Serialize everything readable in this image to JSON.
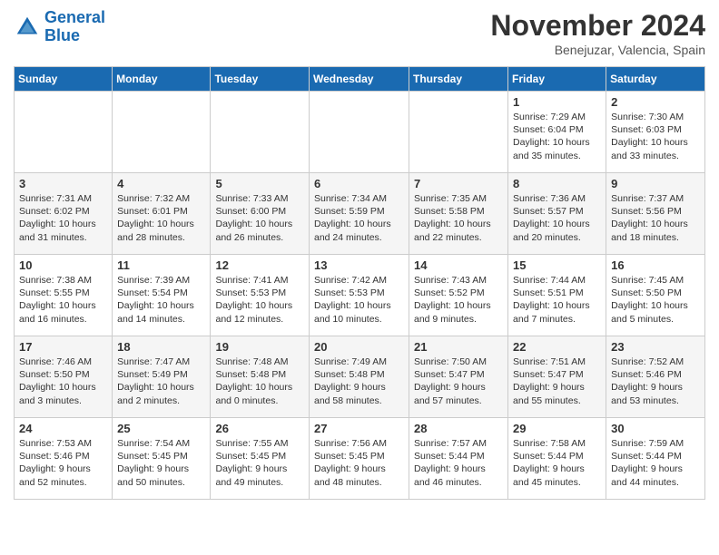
{
  "header": {
    "logo_line1": "General",
    "logo_line2": "Blue",
    "month": "November 2024",
    "location": "Benejuzar, Valencia, Spain"
  },
  "days_of_week": [
    "Sunday",
    "Monday",
    "Tuesday",
    "Wednesday",
    "Thursday",
    "Friday",
    "Saturday"
  ],
  "weeks": [
    [
      {
        "day": "",
        "info": ""
      },
      {
        "day": "",
        "info": ""
      },
      {
        "day": "",
        "info": ""
      },
      {
        "day": "",
        "info": ""
      },
      {
        "day": "",
        "info": ""
      },
      {
        "day": "1",
        "info": "Sunrise: 7:29 AM\nSunset: 6:04 PM\nDaylight: 10 hours\nand 35 minutes."
      },
      {
        "day": "2",
        "info": "Sunrise: 7:30 AM\nSunset: 6:03 PM\nDaylight: 10 hours\nand 33 minutes."
      }
    ],
    [
      {
        "day": "3",
        "info": "Sunrise: 7:31 AM\nSunset: 6:02 PM\nDaylight: 10 hours\nand 31 minutes."
      },
      {
        "day": "4",
        "info": "Sunrise: 7:32 AM\nSunset: 6:01 PM\nDaylight: 10 hours\nand 28 minutes."
      },
      {
        "day": "5",
        "info": "Sunrise: 7:33 AM\nSunset: 6:00 PM\nDaylight: 10 hours\nand 26 minutes."
      },
      {
        "day": "6",
        "info": "Sunrise: 7:34 AM\nSunset: 5:59 PM\nDaylight: 10 hours\nand 24 minutes."
      },
      {
        "day": "7",
        "info": "Sunrise: 7:35 AM\nSunset: 5:58 PM\nDaylight: 10 hours\nand 22 minutes."
      },
      {
        "day": "8",
        "info": "Sunrise: 7:36 AM\nSunset: 5:57 PM\nDaylight: 10 hours\nand 20 minutes."
      },
      {
        "day": "9",
        "info": "Sunrise: 7:37 AM\nSunset: 5:56 PM\nDaylight: 10 hours\nand 18 minutes."
      }
    ],
    [
      {
        "day": "10",
        "info": "Sunrise: 7:38 AM\nSunset: 5:55 PM\nDaylight: 10 hours\nand 16 minutes."
      },
      {
        "day": "11",
        "info": "Sunrise: 7:39 AM\nSunset: 5:54 PM\nDaylight: 10 hours\nand 14 minutes."
      },
      {
        "day": "12",
        "info": "Sunrise: 7:41 AM\nSunset: 5:53 PM\nDaylight: 10 hours\nand 12 minutes."
      },
      {
        "day": "13",
        "info": "Sunrise: 7:42 AM\nSunset: 5:53 PM\nDaylight: 10 hours\nand 10 minutes."
      },
      {
        "day": "14",
        "info": "Sunrise: 7:43 AM\nSunset: 5:52 PM\nDaylight: 10 hours\nand 9 minutes."
      },
      {
        "day": "15",
        "info": "Sunrise: 7:44 AM\nSunset: 5:51 PM\nDaylight: 10 hours\nand 7 minutes."
      },
      {
        "day": "16",
        "info": "Sunrise: 7:45 AM\nSunset: 5:50 PM\nDaylight: 10 hours\nand 5 minutes."
      }
    ],
    [
      {
        "day": "17",
        "info": "Sunrise: 7:46 AM\nSunset: 5:50 PM\nDaylight: 10 hours\nand 3 minutes."
      },
      {
        "day": "18",
        "info": "Sunrise: 7:47 AM\nSunset: 5:49 PM\nDaylight: 10 hours\nand 2 minutes."
      },
      {
        "day": "19",
        "info": "Sunrise: 7:48 AM\nSunset: 5:48 PM\nDaylight: 10 hours\nand 0 minutes."
      },
      {
        "day": "20",
        "info": "Sunrise: 7:49 AM\nSunset: 5:48 PM\nDaylight: 9 hours\nand 58 minutes."
      },
      {
        "day": "21",
        "info": "Sunrise: 7:50 AM\nSunset: 5:47 PM\nDaylight: 9 hours\nand 57 minutes."
      },
      {
        "day": "22",
        "info": "Sunrise: 7:51 AM\nSunset: 5:47 PM\nDaylight: 9 hours\nand 55 minutes."
      },
      {
        "day": "23",
        "info": "Sunrise: 7:52 AM\nSunset: 5:46 PM\nDaylight: 9 hours\nand 53 minutes."
      }
    ],
    [
      {
        "day": "24",
        "info": "Sunrise: 7:53 AM\nSunset: 5:46 PM\nDaylight: 9 hours\nand 52 minutes."
      },
      {
        "day": "25",
        "info": "Sunrise: 7:54 AM\nSunset: 5:45 PM\nDaylight: 9 hours\nand 50 minutes."
      },
      {
        "day": "26",
        "info": "Sunrise: 7:55 AM\nSunset: 5:45 PM\nDaylight: 9 hours\nand 49 minutes."
      },
      {
        "day": "27",
        "info": "Sunrise: 7:56 AM\nSunset: 5:45 PM\nDaylight: 9 hours\nand 48 minutes."
      },
      {
        "day": "28",
        "info": "Sunrise: 7:57 AM\nSunset: 5:44 PM\nDaylight: 9 hours\nand 46 minutes."
      },
      {
        "day": "29",
        "info": "Sunrise: 7:58 AM\nSunset: 5:44 PM\nDaylight: 9 hours\nand 45 minutes."
      },
      {
        "day": "30",
        "info": "Sunrise: 7:59 AM\nSunset: 5:44 PM\nDaylight: 9 hours\nand 44 minutes."
      }
    ]
  ]
}
